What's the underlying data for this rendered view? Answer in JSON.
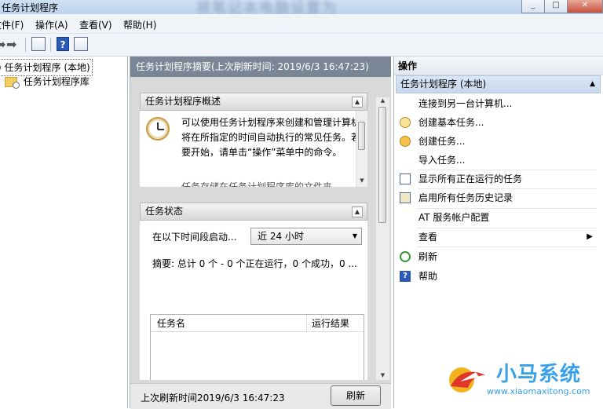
{
  "window": {
    "title": "任务计划程序",
    "blurred_banner": "将笔记本电脑设置为"
  },
  "menu": [
    "文件(F)",
    "操作(A)",
    "查看(V)",
    "帮助(H)"
  ],
  "tree": {
    "root": "任务计划程序 (本地)",
    "child": "任务计划程序库"
  },
  "center": {
    "header": "任务计划程序摘要(上次刷新时间: 2019/6/3 16:47:23)",
    "overview": {
      "title": "任务计划程序概述",
      "description": "可以使用任务计划程序来创建和管理计算机将在所指定的时间自动执行的常见任务。若要开始，请单击“操作”菜单中的命令。",
      "description_more": "任务存储在任务计划程序库的文件夹"
    },
    "status": {
      "title": "任务状态",
      "period_label": "在以下时间段启动...",
      "period_value": "近 24 小时",
      "summary": "摘要: 总计 0 个 - 0 个正在运行，0 个成功，0 ...",
      "columns": [
        "任务名",
        "运行结果"
      ]
    },
    "footer": {
      "last_refresh": "上次刷新时间2019/6/3 16:47:23",
      "refresh_button": "刷新"
    }
  },
  "actions": {
    "title": "操作",
    "group": "任务计划程序 (本地)",
    "items": [
      {
        "label": "连接到另一台计算机...",
        "icon": "none"
      },
      {
        "label": "创建基本任务...",
        "icon": "basic-task-icon"
      },
      {
        "label": "创建任务...",
        "icon": "task-icon"
      },
      {
        "label": "导入任务...",
        "icon": "none"
      },
      {
        "label": "显示所有正在运行的任务",
        "icon": "running-tasks-icon"
      },
      {
        "label": "启用所有任务历史记录",
        "icon": "history-icon"
      },
      {
        "label": "AT 服务帐户配置",
        "icon": "none"
      },
      {
        "label": "查看",
        "icon": "none"
      },
      {
        "label": "刷新",
        "icon": "refresh-icon"
      },
      {
        "label": "帮助",
        "icon": "help-icon"
      }
    ]
  },
  "watermark": {
    "brand": "小马系统",
    "url": "www.xiaomaxitong.com"
  },
  "colors": {
    "center_header": "#7a8696",
    "action_group": "#c6d6ec",
    "watermark": "#37a0e8"
  }
}
